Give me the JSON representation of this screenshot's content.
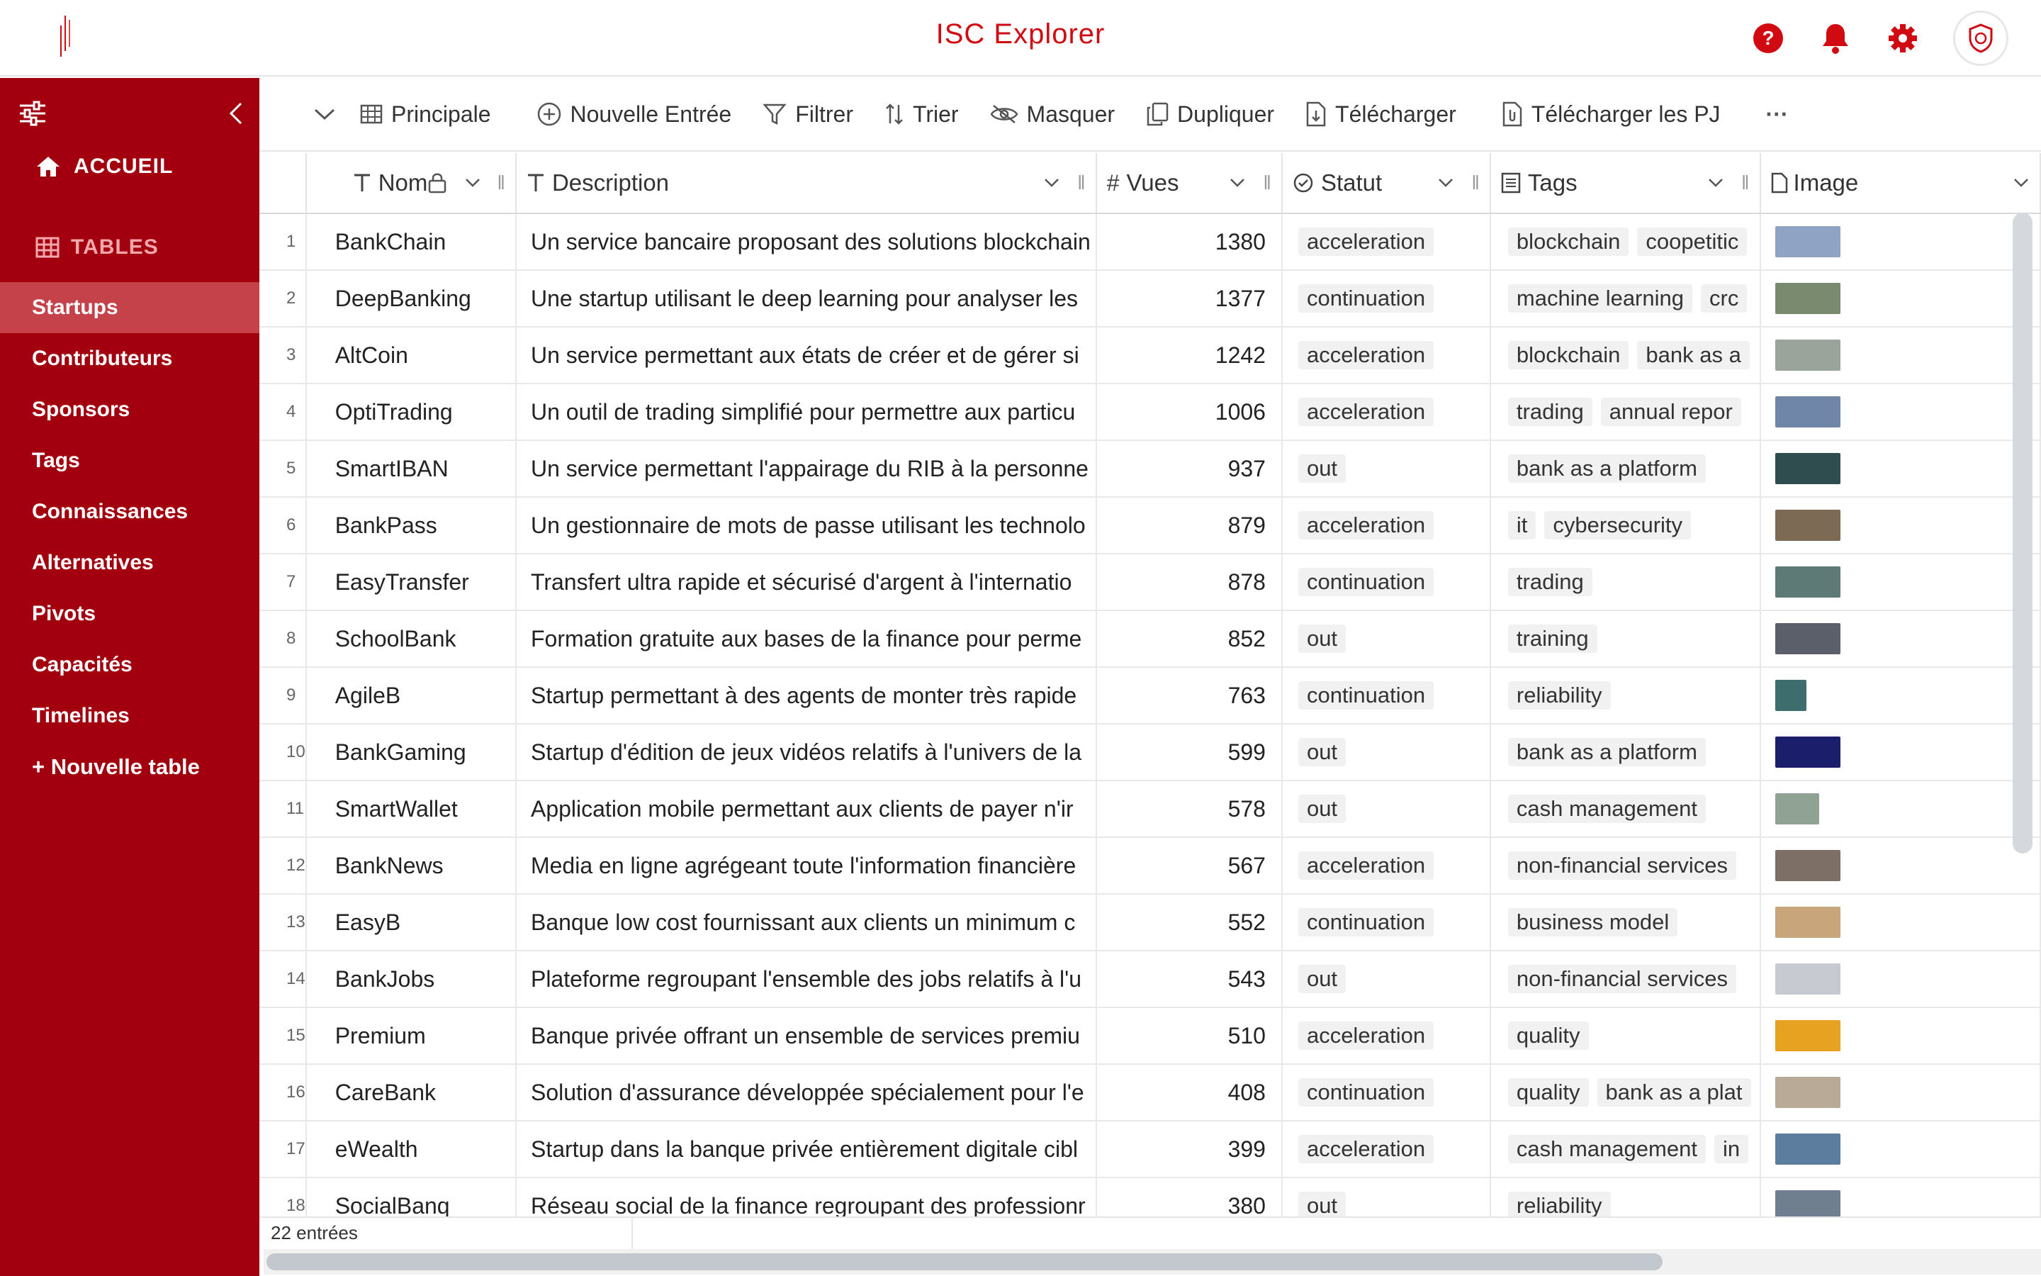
{
  "app": {
    "title": "ISC Explorer"
  },
  "colors": {
    "brand": "#d10a11",
    "sidebar": "#a3000f",
    "sidebar_active": "#c5424b"
  },
  "topbar": {
    "icons": [
      "help-icon",
      "bell-icon",
      "gear-icon",
      "shield-avatar-icon"
    ]
  },
  "sidebar": {
    "home_label": "ACCUEIL",
    "tables_label": "TABLES",
    "items": [
      {
        "label": "Startups",
        "active": true
      },
      {
        "label": "Contributeurs"
      },
      {
        "label": "Sponsors"
      },
      {
        "label": "Tags"
      },
      {
        "label": "Connaissances"
      },
      {
        "label": "Alternatives"
      },
      {
        "label": "Pivots"
      },
      {
        "label": "Capacités"
      },
      {
        "label": "Timelines"
      }
    ],
    "new_table_label": "Nouvelle table"
  },
  "toolbar": {
    "view": "Principale",
    "new_entry": "Nouvelle Entrée",
    "filter": "Filtrer",
    "sort": "Trier",
    "hide": "Masquer",
    "duplicate": "Dupliquer",
    "download": "Télécharger",
    "download_attachments": "Télécharger les PJ",
    "more": "···"
  },
  "table": {
    "columns": {
      "name": "Nom",
      "description": "Description",
      "views": "Vues",
      "status": "Statut",
      "tags": "Tags",
      "image": "Image"
    },
    "rows": [
      {
        "idx": "1",
        "name": "BankChain",
        "desc": "Un service bancaire proposant des solutions blockchain",
        "views": "1380",
        "status": "acceleration",
        "tags": [
          "blockchain",
          "coopetitic"
        ],
        "img": "#8fa3c4"
      },
      {
        "idx": "2",
        "name": "DeepBanking",
        "desc": "Une startup utilisant le deep learning pour analyser les",
        "views": "1377",
        "status": "continuation",
        "tags": [
          "machine learning",
          "crc"
        ],
        "img": "#7a8a6e"
      },
      {
        "idx": "3",
        "name": "AltCoin",
        "desc": "Un service permettant aux états de créer et de gérer si",
        "views": "1242",
        "status": "acceleration",
        "tags": [
          "blockchain",
          "bank as a"
        ],
        "img": "#9aa49a"
      },
      {
        "idx": "4",
        "name": "OptiTrading",
        "desc": "Un outil de trading simplifié pour permettre aux particu",
        "views": "1006",
        "status": "acceleration",
        "tags": [
          "trading",
          "annual repor"
        ],
        "img": "#6f86a8"
      },
      {
        "idx": "5",
        "name": "SmartIBAN",
        "desc": "Un service permettant l'appairage du RIB à la personne",
        "views": "937",
        "status": "out",
        "tags": [
          "bank as a platform"
        ],
        "img": "#2f4d4e"
      },
      {
        "idx": "6",
        "name": "BankPass",
        "desc": "Un gestionnaire de mots de passe utilisant les technolo",
        "views": "879",
        "status": "acceleration",
        "tags": [
          "it",
          "cybersecurity"
        ],
        "img": "#7c6a55"
      },
      {
        "idx": "7",
        "name": "EasyTransfer",
        "desc": "Transfert ultra rapide et sécurisé d'argent à l'internatio",
        "views": "878",
        "status": "continuation",
        "tags": [
          "trading"
        ],
        "img": "#5d7a77"
      },
      {
        "idx": "8",
        "name": "SchoolBank",
        "desc": "Formation gratuite aux bases de la finance pour perme",
        "views": "852",
        "status": "out",
        "tags": [
          "training"
        ],
        "img": "#5a5f69"
      },
      {
        "idx": "9",
        "name": "AgileB",
        "desc": "Startup permettant à des agents de monter très rapide",
        "views": "763",
        "status": "continuation",
        "tags": [
          "reliability"
        ],
        "img": "#3e6d6e"
      },
      {
        "idx": "10",
        "name": "BankGaming",
        "desc": "Startup d'édition de jeux vidéos relatifs à l'univers de la",
        "views": "599",
        "status": "out",
        "tags": [
          "bank as a platform"
        ],
        "img": "#1b1f6b"
      },
      {
        "idx": "11",
        "name": "SmartWallet",
        "desc": "Application mobile permettant aux clients de payer n'ir",
        "views": "578",
        "status": "out",
        "tags": [
          "cash management"
        ],
        "img": "#8fa293"
      },
      {
        "idx": "12",
        "name": "BankNews",
        "desc": "Media en ligne agrégeant toute l'information financière",
        "views": "567",
        "status": "acceleration",
        "tags": [
          "non-financial services"
        ],
        "img": "#7d6f66"
      },
      {
        "idx": "13",
        "name": "EasyB",
        "desc": "Banque low cost fournissant aux clients un minimum c",
        "views": "552",
        "status": "continuation",
        "tags": [
          "business model"
        ],
        "img": "#c8a57a"
      },
      {
        "idx": "14",
        "name": "BankJobs",
        "desc": "Plateforme regroupant l'ensemble des jobs relatifs à l'u",
        "views": "543",
        "status": "out",
        "tags": [
          "non-financial services"
        ],
        "img": "#c7cbd1"
      },
      {
        "idx": "15",
        "name": "Premium",
        "desc": "Banque privée offrant un ensemble de services premiu",
        "views": "510",
        "status": "acceleration",
        "tags": [
          "quality"
        ],
        "img": "#e6a220"
      },
      {
        "idx": "16",
        "name": "CareBank",
        "desc": "Solution d'assurance développée spécialement pour l'e",
        "views": "408",
        "status": "continuation",
        "tags": [
          "quality",
          "bank as a plat"
        ],
        "img": "#b9aa98"
      },
      {
        "idx": "17",
        "name": "eWealth",
        "desc": "Startup dans la banque privée entièrement digitale cibl",
        "views": "399",
        "status": "acceleration",
        "tags": [
          "cash management",
          "in"
        ],
        "img": "#5d7d9e"
      },
      {
        "idx": "18",
        "name": "SocialBanq",
        "desc": "Réseau social de la finance regroupant des professionr",
        "views": "380",
        "status": "out",
        "tags": [
          "reliability"
        ],
        "img": "#6f7f90"
      }
    ]
  },
  "footer": {
    "count": "22 entrées"
  }
}
